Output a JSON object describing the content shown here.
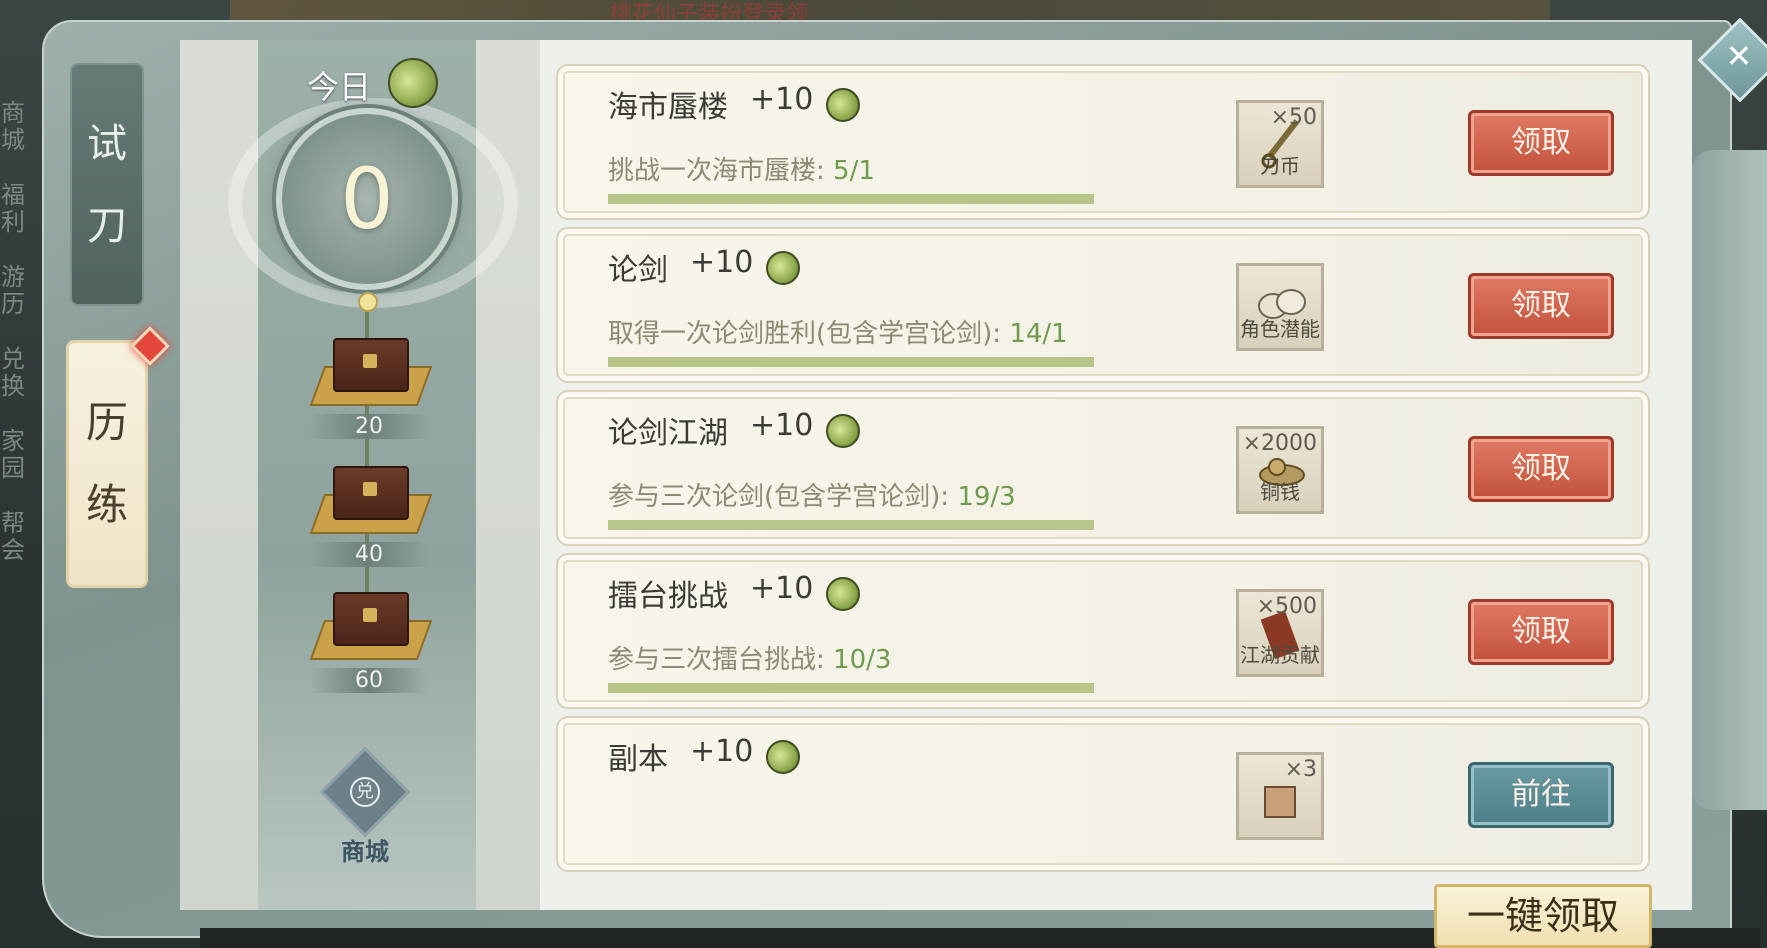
{
  "top_banner": "桃花仙子装扮登录领",
  "outer_menu": [
    "商城",
    "福利",
    "游历",
    "兑换",
    "家园",
    "帮会"
  ],
  "tabs": [
    {
      "label": "试刀",
      "selected": false
    },
    {
      "label": "历练",
      "selected": true
    }
  ],
  "today": {
    "label": "今日",
    "value": "0"
  },
  "milestones": [
    "20",
    "40",
    "60"
  ],
  "shop": {
    "label": "商城",
    "icon_glyph": "兑"
  },
  "tasks": [
    {
      "title": "海市蜃楼",
      "points": "+10",
      "desc": "挑战一次海市蜃楼: ",
      "progress": "5/1",
      "fill": 1.0,
      "reward": {
        "qty": "×50",
        "name": "刀币",
        "icon": "sword-coin-icon"
      },
      "button": "领取"
    },
    {
      "title": "论剑",
      "points": "+10",
      "desc": "取得一次论剑胜利(包含学宫论剑): ",
      "progress": "14/1",
      "fill": 1.0,
      "reward": {
        "qty": "",
        "name": "角色潜能",
        "icon": "potential-stones-icon"
      },
      "button": "领取"
    },
    {
      "title": "论剑江湖",
      "points": "+10",
      "desc": "参与三次论剑(包含学宫论剑): ",
      "progress": "19/3",
      "fill": 1.0,
      "reward": {
        "qty": "×2000",
        "name": "铜钱",
        "icon": "copper-coins-icon"
      },
      "button": "领取"
    },
    {
      "title": "擂台挑战",
      "points": "+10",
      "desc": "参与三次擂台挑战: ",
      "progress": "10/3",
      "fill": 1.0,
      "reward": {
        "qty": "×500",
        "name": "江湖贡献",
        "icon": "contribution-scroll-icon"
      },
      "button": "领取"
    },
    {
      "title": "副本",
      "points": "+10",
      "desc": "",
      "progress": "",
      "fill": 0,
      "reward": {
        "qty": "×3",
        "name": "",
        "icon": "item-icon"
      },
      "button": "前往"
    }
  ],
  "one_click_claim": "一键领取",
  "colors": {
    "claim_red": "#c2513d",
    "goto_teal": "#4c7f88",
    "progress_green": "#b7c588",
    "accent_gold": "#d4b56a"
  }
}
